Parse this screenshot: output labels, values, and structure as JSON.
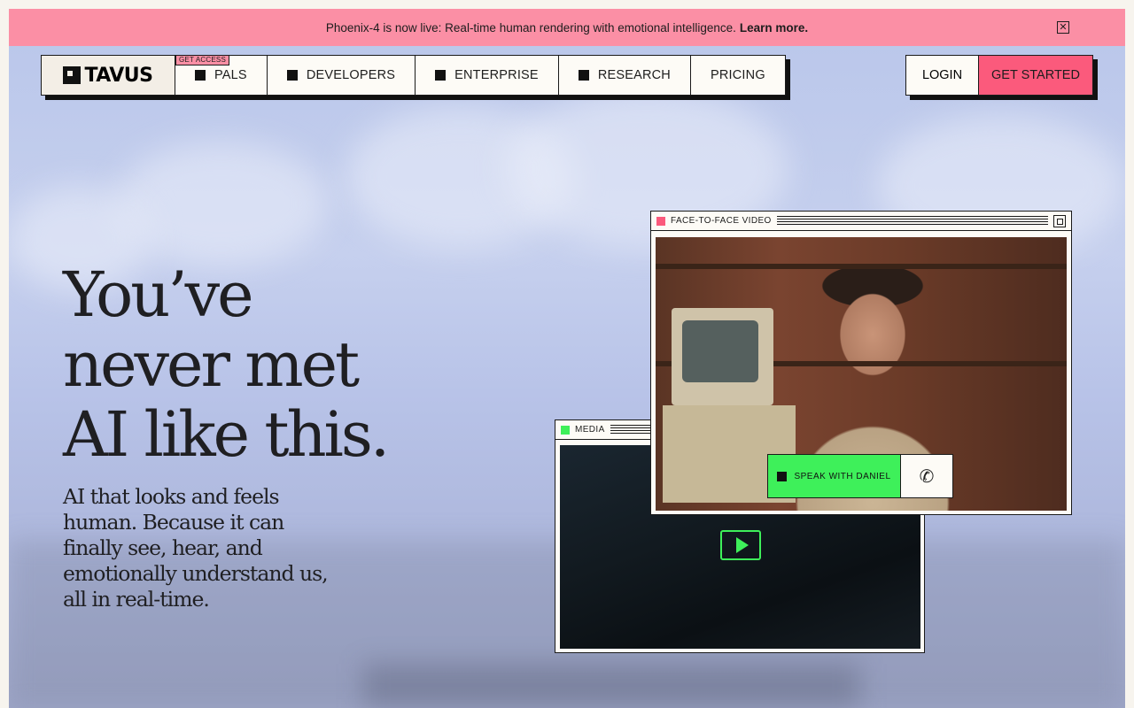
{
  "banner": {
    "text": "Phoenix-4 is now live: Real-time human rendering with emotional intelligence.",
    "link": "Learn more.",
    "close_glyph": "✕"
  },
  "nav": {
    "logo": "TAVUS",
    "tag": "GET ACCESS",
    "items": [
      {
        "label": "PALS"
      },
      {
        "label": "DEVELOPERS"
      },
      {
        "label": "ENTERPRISE"
      },
      {
        "label": "RESEARCH"
      },
      {
        "label": "PRICING"
      }
    ],
    "login": "LOGIN",
    "get_started": "GET STARTED"
  },
  "hero": {
    "title_lines": [
      "You’ve",
      "never met",
      "AI like this."
    ],
    "subtitle": "AI that looks and feels human. Because it can finally see, hear, and emotionally understand us, all in real-time."
  },
  "media_window": {
    "label": "MEDIA",
    "indicator_color": "#3ef05a"
  },
  "video_window": {
    "label": "FACE-TO-FACE VIDEO",
    "indicator_color": "#fb5a7c",
    "cta": "SPEAK WITH DANIEL",
    "phone_glyph": "✆"
  },
  "colors": {
    "banner": "#fb8fa5",
    "accent_pink": "#fb5a7c",
    "accent_green": "#3ef05a"
  }
}
